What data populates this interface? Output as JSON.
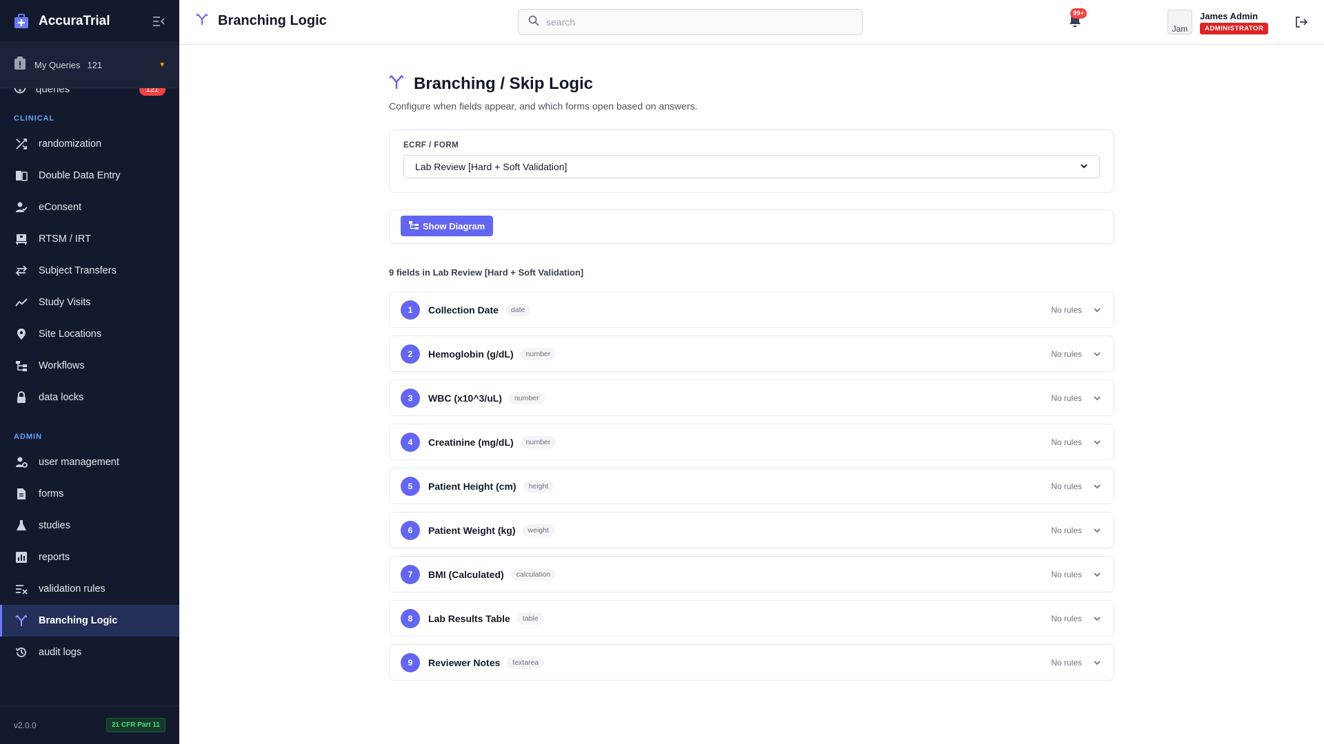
{
  "app": {
    "name": "AccuraTrial",
    "version": "v2.0.0",
    "compliance": "21 CFR Part 11"
  },
  "queries_bar": {
    "label": "My Queries",
    "count": "121"
  },
  "cutoff_item": {
    "label": "queries",
    "badge": "121"
  },
  "sidebar": {
    "sections": [
      {
        "label": "CLINICAL",
        "items": [
          {
            "label": "randomization",
            "icon": "shuffle-icon"
          },
          {
            "label": "Double Data Entry",
            "icon": "double-page-icon"
          },
          {
            "label": "eConsent",
            "icon": "user-check-icon"
          },
          {
            "label": "RTSM / IRT",
            "icon": "pallet-icon"
          },
          {
            "label": "Subject Transfers",
            "icon": "transfer-icon"
          },
          {
            "label": "Study Visits",
            "icon": "trend-icon"
          },
          {
            "label": "Site Locations",
            "icon": "map-pin-icon"
          },
          {
            "label": "Workflows",
            "icon": "workflow-icon"
          },
          {
            "label": "data locks",
            "icon": "lock-icon"
          }
        ]
      },
      {
        "label": "ADMIN",
        "items": [
          {
            "label": "user management",
            "icon": "user-gear-icon"
          },
          {
            "label": "forms",
            "icon": "document-icon"
          },
          {
            "label": "studies",
            "icon": "flask-icon"
          },
          {
            "label": "reports",
            "icon": "bar-chart-icon"
          },
          {
            "label": "validation rules",
            "icon": "list-check-icon"
          },
          {
            "label": "Branching Logic",
            "icon": "branch-icon",
            "active": true
          },
          {
            "label": "audit logs",
            "icon": "history-icon"
          }
        ]
      }
    ]
  },
  "topbar": {
    "title": "Branching Logic",
    "search_placeholder": "search",
    "notifications_badge": "99+",
    "avatar_alt": "Jam",
    "user_name": "James Admin",
    "user_role": "ADMINISTRATOR"
  },
  "main": {
    "heading": "Branching / Skip Logic",
    "subtitle": "Configure when fields appear, and which forms open based on answers.",
    "form_label": "ECRF / FORM",
    "form_selected": "Lab Review [Hard + Soft Validation]",
    "diagram_button": "Show Diagram",
    "fields_heading": "9 fields in Lab Review [Hard + Soft Validation]",
    "fields": [
      {
        "num": "1",
        "name": "Collection Date",
        "type": "date",
        "status": "No rules"
      },
      {
        "num": "2",
        "name": "Hemoglobin (g/dL)",
        "type": "number",
        "status": "No rules"
      },
      {
        "num": "3",
        "name": "WBC (x10^3/uL)",
        "type": "number",
        "status": "No rules"
      },
      {
        "num": "4",
        "name": "Creatinine (mg/dL)",
        "type": "number",
        "status": "No rules"
      },
      {
        "num": "5",
        "name": "Patient Height (cm)",
        "type": "height",
        "status": "No rules"
      },
      {
        "num": "6",
        "name": "Patient Weight (kg)",
        "type": "weight",
        "status": "No rules"
      },
      {
        "num": "7",
        "name": "BMI (Calculated)",
        "type": "calculation",
        "status": "No rules"
      },
      {
        "num": "8",
        "name": "Lab Results Table",
        "type": "table",
        "status": "No rules"
      },
      {
        "num": "9",
        "name": "Reviewer Notes",
        "type": "textarea",
        "status": "No rules"
      }
    ]
  },
  "colors": {
    "sidebar_bg": "#141a2e",
    "accent": "#6366f1",
    "danger": "#ef4444",
    "compliance": "#4ade80"
  }
}
